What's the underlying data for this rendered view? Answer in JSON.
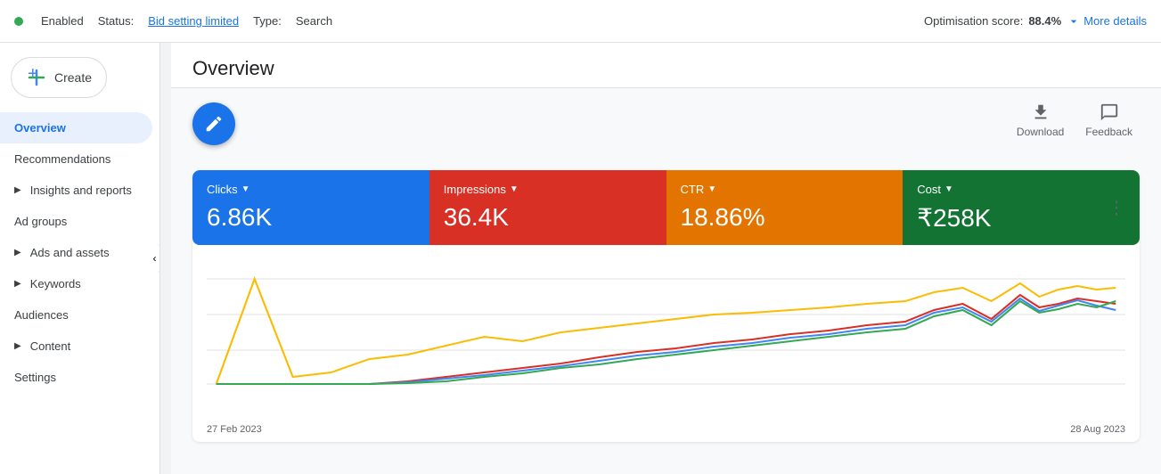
{
  "topbar": {
    "enabled_label": "Enabled",
    "status_prefix": "Status:",
    "status_value": "Bid setting limited",
    "type_prefix": "Type:",
    "type_value": "Search",
    "opt_score_prefix": "Optimisation score:",
    "opt_score_value": "88.4%",
    "more_details_label": "More details"
  },
  "sidebar": {
    "create_label": "Create",
    "nav_items": [
      {
        "id": "overview",
        "label": "Overview",
        "active": true,
        "has_chevron": false
      },
      {
        "id": "recommendations",
        "label": "Recommendations",
        "active": false,
        "has_chevron": false
      },
      {
        "id": "insights",
        "label": "Insights and reports",
        "active": false,
        "has_chevron": true
      },
      {
        "id": "ad-groups",
        "label": "Ad groups",
        "active": false,
        "has_chevron": false
      },
      {
        "id": "ads-assets",
        "label": "Ads and assets",
        "active": false,
        "has_chevron": true
      },
      {
        "id": "keywords",
        "label": "Keywords",
        "active": false,
        "has_chevron": true
      },
      {
        "id": "audiences",
        "label": "Audiences",
        "active": false,
        "has_chevron": false
      },
      {
        "id": "content",
        "label": "Content",
        "active": false,
        "has_chevron": true
      },
      {
        "id": "settings",
        "label": "Settings",
        "active": false,
        "has_chevron": false
      }
    ]
  },
  "overview": {
    "title": "Overview",
    "toolbar": {
      "download_label": "Download",
      "feedback_label": "Feedback"
    },
    "metrics": [
      {
        "id": "clicks",
        "label": "Clicks",
        "value": "6.86K",
        "color_class": "clicks"
      },
      {
        "id": "impressions",
        "label": "Impressions",
        "value": "36.4K",
        "color_class": "impressions"
      },
      {
        "id": "ctr",
        "label": "CTR",
        "value": "18.86%",
        "color_class": "ctr"
      },
      {
        "id": "cost",
        "label": "Cost",
        "value": "₹258K",
        "color_class": "cost"
      }
    ],
    "chart": {
      "start_date": "27 Feb 2023",
      "end_date": "28 Aug 2023"
    }
  }
}
